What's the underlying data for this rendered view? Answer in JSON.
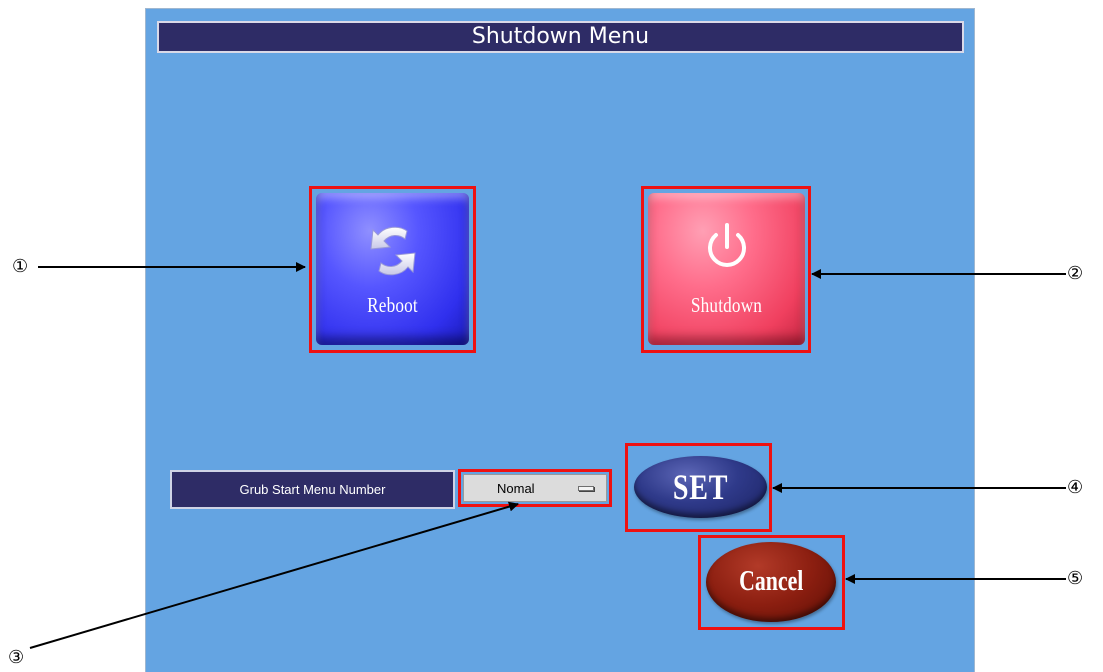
{
  "window": {
    "title": "Shutdown Menu"
  },
  "buttons": {
    "reboot_label": "Reboot",
    "shutdown_label": "Shutdown",
    "set_label": "SET",
    "cancel_label": "Cancel"
  },
  "grub": {
    "label": "Grub Start Menu Number",
    "selected_value": "Nomal"
  },
  "callouts": [
    "①",
    "②",
    "③",
    "④",
    "⑤"
  ],
  "icons": {
    "reboot": "refresh-arrows-icon",
    "shutdown": "power-icon",
    "dropdown": "option-menu-indicator-icon"
  },
  "colors": {
    "background": "#64a4e2",
    "title_bar": "#2e2c66",
    "highlight": "#ee1111",
    "reboot_button": "#4040ff",
    "shutdown_button": "#f55371",
    "set_button": "#2f3a8a",
    "cancel_button": "#8b1e10"
  }
}
